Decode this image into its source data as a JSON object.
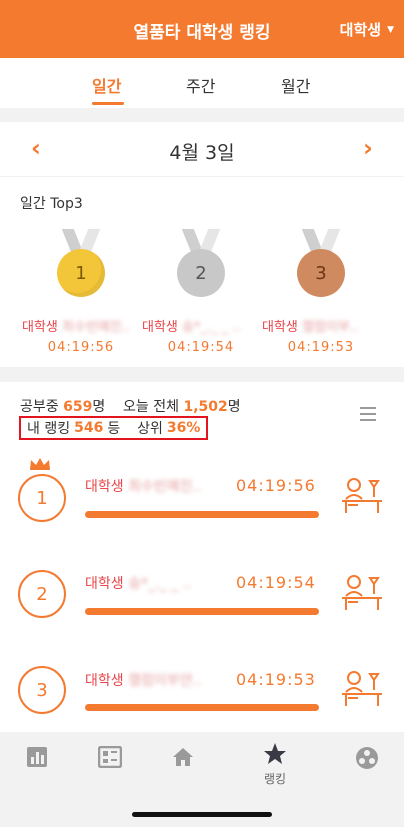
{
  "header": {
    "title": "열품타 대학생 랭킹",
    "category": "대학생"
  },
  "tabs": [
    {
      "label": "일간",
      "active": true
    },
    {
      "label": "주간",
      "active": false
    },
    {
      "label": "월간",
      "active": false
    }
  ],
  "datebar": {
    "date": "4월  3일",
    "prev_icon": "chevron-left-icon",
    "next_icon": "chevron-right-icon"
  },
  "top3": {
    "heading": "일간 Top3",
    "podium": [
      {
        "rank": "1",
        "group": "대학생",
        "name": "최수빈예진..",
        "time": "04:19:56",
        "medal": "gold"
      },
      {
        "rank": "2",
        "group": "대학생",
        "name": "승*_._ _ ..",
        "time": "04:19:54",
        "medal": "silver"
      },
      {
        "rank": "3",
        "group": "대학생",
        "name": "캘럼이부..",
        "time": "04:19:53",
        "medal": "bronze"
      }
    ]
  },
  "stats": {
    "studying_label": "공부중",
    "studying_count": "659",
    "studying_unit": "명",
    "total_label": "오늘 전체",
    "total_count": "1,502",
    "total_unit": "명"
  },
  "my_rank": {
    "label": "내 랭킹",
    "rank": "546",
    "rank_unit": "등",
    "top_label": "상위",
    "top_percent": "36%"
  },
  "ranking_list": [
    {
      "rank": "1",
      "group": "대학생",
      "name": "최수빈예진..",
      "time": "04:19:56",
      "crown": true
    },
    {
      "rank": "2",
      "group": "대학생",
      "name": "승*_._ _ ..",
      "time": "04:19:54",
      "crown": false
    },
    {
      "rank": "3",
      "group": "대학생",
      "name": "캘럼이부얀..",
      "time": "04:19:53",
      "crown": false
    }
  ],
  "bottom_nav": [
    {
      "icon": "bar-chart-icon",
      "label": ""
    },
    {
      "icon": "planner-icon",
      "label": ""
    },
    {
      "icon": "home-icon",
      "label": ""
    },
    {
      "icon": "star-icon",
      "label": "랭킹",
      "active": true
    },
    {
      "icon": "group-icon",
      "label": ""
    }
  ],
  "colors": {
    "accent": "#f47a30",
    "name_red": "#e8474b",
    "highlight_box": "#e4141f"
  }
}
